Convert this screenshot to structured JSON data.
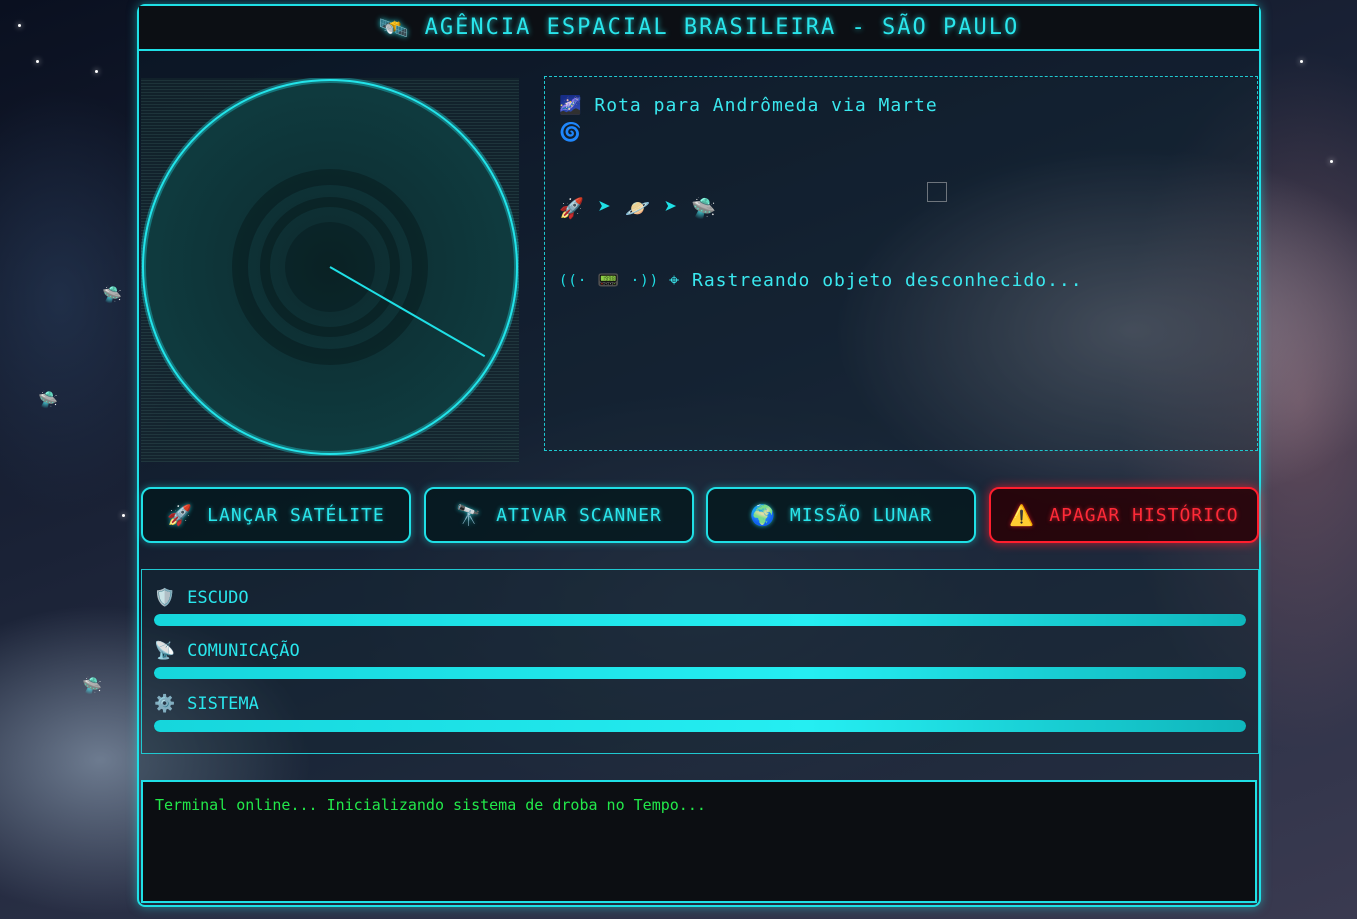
{
  "header": {
    "logo_icon": "satellite-icon",
    "title": "AGÊNCIA ESPACIAL BRASILEIRA - SÃO PAULO"
  },
  "radar": {
    "sweep_angle_deg": 30
  },
  "route": {
    "title_icon": "galaxy-icon",
    "title": "Rota para Andrômeda via Marte",
    "path_icons": [
      "rocket-icon",
      "planet-icon",
      "ufo-icon"
    ],
    "tracking_text": "⌖ Rastreando objeto desconhecido..."
  },
  "buttons": {
    "launch": {
      "label": "LANÇAR SATÉLITE",
      "icon": "rocket-icon"
    },
    "scanner": {
      "label": "ATIVAR SCANNER",
      "icon": "telescope-icon"
    },
    "lunar": {
      "label": "MISSÃO LUNAR",
      "icon": "earth-icon"
    },
    "clear": {
      "label": "APAGAR HISTÓRICO",
      "icon": "warning-icon"
    }
  },
  "status": [
    {
      "label": "ESCUDO",
      "icon": "shield-icon",
      "level": 1.0
    },
    {
      "label": "COMUNICAÇÃO",
      "icon": "antenna-icon",
      "level": 1.0
    },
    {
      "label": "SISTEMA",
      "icon": "gear-icon",
      "level": 1.0
    }
  ],
  "terminal": {
    "line": "Terminal online... Inicializando sistema de droba no Tempo..."
  },
  "colors": {
    "accent": "#1fe0e6",
    "danger": "#ff1e2e",
    "terminal_text": "#22e84a"
  }
}
